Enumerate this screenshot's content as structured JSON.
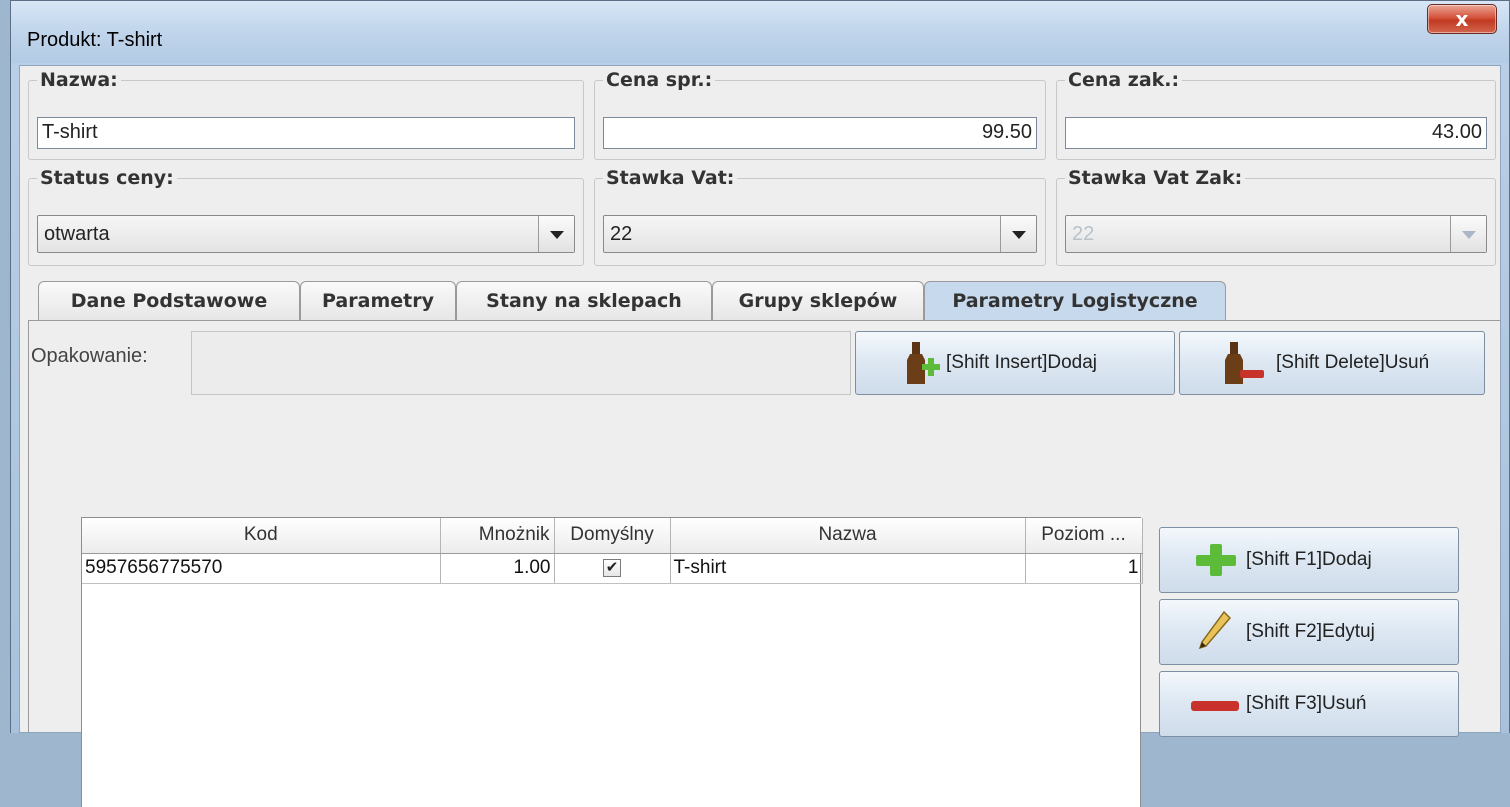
{
  "window": {
    "title": "Produkt: T-shirt",
    "close_label": "x"
  },
  "fields": {
    "nazwa": {
      "label": "Nazwa:",
      "value": "T-shirt"
    },
    "cena_spr": {
      "label": "Cena spr.:",
      "value": "99.50"
    },
    "cena_zak": {
      "label": "Cena zak.:",
      "value": "43.00"
    },
    "status_ceny": {
      "label": "Status ceny:",
      "value": "otwarta"
    },
    "stawka_vat": {
      "label": "Stawka Vat:",
      "value": "22"
    },
    "stawka_vat_zak": {
      "label": "Stawka Vat Zak:",
      "value": "22",
      "disabled": true
    }
  },
  "tabs": [
    {
      "label": "Dane Podstawowe",
      "active": false
    },
    {
      "label": "Parametry",
      "active": false
    },
    {
      "label": "Stany na sklepach",
      "active": false
    },
    {
      "label": "Grupy sklepów",
      "active": false
    },
    {
      "label": "Parametry Logistyczne",
      "active": true
    }
  ],
  "packaging": {
    "label": "Opakowanie:",
    "value": "",
    "add_button": "[Shift Insert]Dodaj",
    "delete_button": "[Shift Delete]Usuń",
    "add_icon": "bottle-add-icon",
    "delete_icon": "bottle-remove-icon"
  },
  "barcode_table": {
    "columns": [
      "Kod",
      "Mnożnik",
      "Domyślny",
      "Nazwa",
      "Poziom ..."
    ],
    "rows": [
      {
        "kod": "5957656775570",
        "mnoznik": "1.00",
        "domyslny": true,
        "nazwa": "T-shirt",
        "poziom": "1"
      }
    ]
  },
  "side_buttons": {
    "add": {
      "label": "[Shift F1]Dodaj",
      "icon": "plus-icon"
    },
    "edit": {
      "label": "[Shift F2]Edytuj",
      "icon": "pencil-icon"
    },
    "delete": {
      "label": "[Shift F3]Usuń",
      "icon": "minus-icon"
    }
  },
  "colors": {
    "active_tab": "#c7d9ec",
    "close_button": "#c13a22",
    "plus_green": "#5dbb3a",
    "minus_red": "#c9322b"
  }
}
